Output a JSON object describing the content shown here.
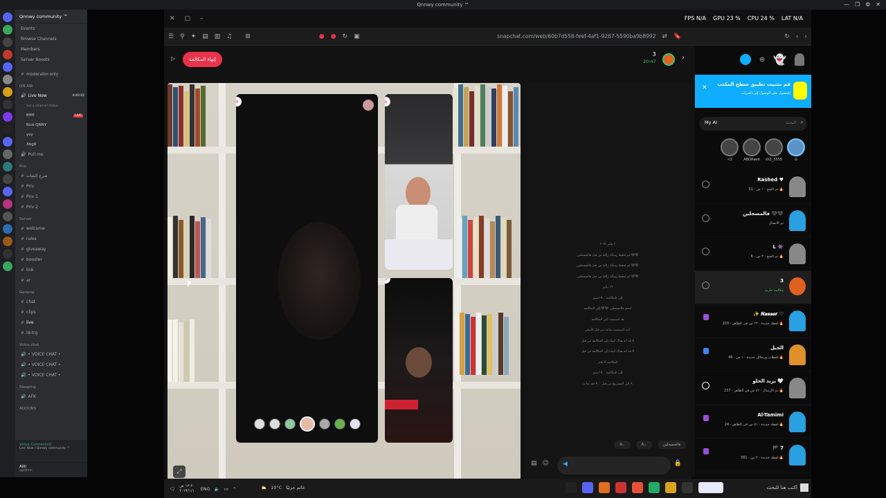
{
  "os": {
    "title": "Qnnwy community ™",
    "taskbar_search": "اكتب هنا للبحث",
    "weather": "10°C",
    "weather_text": "غائم جزئيًا",
    "clock_time": "١٢:٢٠ ص",
    "clock_date": "٢٠٢٣/١/١٠",
    "lang": "ENG"
  },
  "perf": {
    "fps": "FPS N/A",
    "gpu": "GPU 23 %",
    "cpu": "CPU 24 %",
    "lat": "LAT N/A"
  },
  "discord": {
    "server_name": "Qnnwy community ™",
    "top_items": [
      "Events",
      "Browse Channels",
      "Members",
      "Server Boosts"
    ],
    "mod_channel": "moderator-only",
    "on_air_category": "ON AIR",
    "live_now": "Live Now",
    "live_timer": "4:43:42",
    "live_sub": "Set a channel status",
    "live_badge": "LIVE",
    "voice_members": [
      "ffffff",
      "Rick QNNY",
      "yvy",
      "Xbg8"
    ],
    "pull_me": "Pull me",
    "priv_category": "Priv",
    "priv_channels": [
      "شرح الشات",
      "Priv",
      "Priv 1",
      "Priv 2"
    ],
    "server_category": "Server",
    "server_channels": [
      "welcome",
      "rules",
      "giveaway",
      "booster",
      "link",
      "ar"
    ],
    "general_category": "General",
    "general_channels": [
      "chat",
      "clips",
      "live",
      "ld-trg"
    ],
    "voice_category": "Voice chat",
    "voice_channels": [
      "• VOICE CHAT •",
      "• VOICE CHAT •",
      "• VOICE CHAT •"
    ],
    "sleeping_category": "Sleeping",
    "afk": "AFK",
    "addons_category": "ADDONS",
    "voice_connected": "Voice Connected",
    "voice_location": "Live Now / Qnnwy community ™",
    "username": "Allll",
    "user_tag": "gg/qhnn"
  },
  "browser": {
    "url": "snapchat.com/web/60b7d558-feef-4af1-9267-5590ba9b8992"
  },
  "call": {
    "end_call": "إنهاء المكالمة",
    "participants": "3",
    "timer": "20:47"
  },
  "chat": {
    "messages": [
      "٣ يناير ٢٠٢٤",
      "لم تحفظ رسالة زائلة من قبل فالمسجلين 🖤🖤",
      "لم تحفظ رسالة زائلة من قبل فالمسجلين 🖤🖤",
      "لم تحفظ رسالة زائلة من قبل فالمسجلين 🖤🖤",
      "١٦ يناير",
      "انضم A .. إلى المكالمة",
      "انضم فالمسجلين 🖤🖤 إلى المكالمة",
      "قد انضممت إلى المكالمة",
      "أنت انضممت ساعد من قبل الأبيض",
      "قد أنه هناك انتباه إلى المكالمة من قبل A",
      "قد أنه هناك انتباه إلى المكالمة من قبل A",
      "غادر A المكالمة",
      "انضم A .. إلى المكالمة",
      "لقد بدأت A .. إلى المشروع من قبل A"
    ],
    "actions": [
      "فالمسجلين",
      "A..",
      "A.."
    ]
  },
  "sidebar": {
    "banner_title": "قم بتثبيت تطبيق سطح المكتب",
    "banner_sub": "للحصول على الوصول إلى الميزات",
    "my_ai": "My AI",
    "search_placeholder": "البحث",
    "stories": [
      "<3",
      "ABORaed",
      "sh3_5555",
      "G"
    ],
    "friends": [
      {
        "name": "Rashed ♥",
        "status": "تم الفتح · ١ س · 51 🔥"
      },
      {
        "name": "فالمسجلين 🖤🖤",
        "status": "تم الاتصال"
      },
      {
        "name": "L 👾",
        "status": "تم الفتح · ٣ س · 6 🔥"
      },
      {
        "name": "3",
        "status": "مكالمة جارية"
      },
      {
        "name": "✨ 𝑵𝒂𝒔𝒔𝒆𝒓 ♡",
        "status": "لقطة جديدة · ١٣ س فى الظاهر · 203 🔥"
      },
      {
        "name": "الجبل",
        "status": "لقطات ورسائل جديدة · ١ س · 46 🔥"
      },
      {
        "name": "يزيد الحلو 🤍",
        "status": "تم الإرسال · ٤٢ س فى الظاهر · 237 🔥"
      },
      {
        "name": "Al-Tamimi",
        "status": "لقطة جديدة · ٥١ س فى الظاهر · 24 🔥"
      },
      {
        "name": "🏴 7",
        "status": "لقطة جديدة · ٢ س · 381 🔥"
      }
    ]
  },
  "colors": {
    "snap_yellow": "#fffc00",
    "end_call_red": "#e8334a",
    "banner_blue": "#0eadff",
    "discord_bg": "#2b2d31"
  }
}
